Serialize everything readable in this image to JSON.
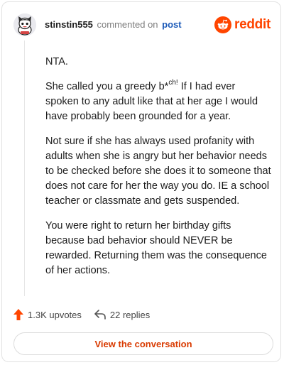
{
  "header": {
    "username": "stinstin555",
    "action_text": "commented on",
    "post_link": "post",
    "logo_text": "reddit"
  },
  "comment": {
    "paragraphs": [
      {
        "text": "NTA."
      },
      {
        "before": "She called you a greedy b",
        "censor": "*",
        "sup": "ch!",
        "after": " If I had ever spoken to any adult like that at her age I would have probably been grounded for a year."
      },
      {
        "text": "Not sure if she has always used profanity with adults when she is angry but her behavior needs to be checked before she does it to someone that does not care for her the way you do. IE a school teacher or classmate and gets suspended."
      },
      {
        "text": "You were right to return her birthday gifts because bad behavior should NEVER be rewarded. Returning them was the consequence of her actions."
      }
    ]
  },
  "actions": {
    "upvotes": "1.3K upvotes",
    "replies": "22 replies"
  },
  "cta": {
    "label": "View the conversation"
  },
  "colors": {
    "brand": "#ff4500",
    "link": "#1c5ab8",
    "cta_text": "#d93a00"
  },
  "icons": [
    "avatar",
    "reddit-logo-icon",
    "upvote-arrow-icon",
    "reply-arrow-icon"
  ]
}
